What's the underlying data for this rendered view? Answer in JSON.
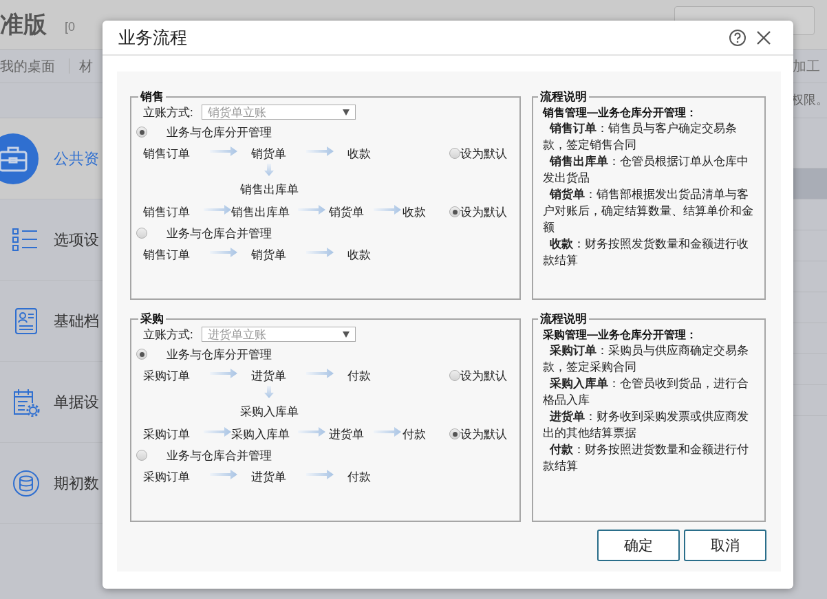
{
  "app": {
    "title": "准版",
    "code": "[0",
    "nav": [
      "我的桌面",
      "材"
    ],
    "nav_right": "加工",
    "notice": "权限。",
    "rows": [
      {
        "selected": false
      },
      {
        "selected": true
      },
      {
        "selected": false
      },
      {
        "selected": false
      },
      {
        "selected": false
      },
      {
        "selected": false
      },
      {
        "selected": false
      },
      {
        "selected": false
      },
      {
        "selected": false
      }
    ]
  },
  "sidebar": {
    "items": [
      {
        "label": "公共资",
        "selected": true
      },
      {
        "label": "选项设",
        "selected": false
      },
      {
        "label": "基础档",
        "selected": false
      },
      {
        "label": "单据设",
        "selected": false
      },
      {
        "label": "期初数",
        "selected": false
      }
    ]
  },
  "dialog": {
    "title": "业务流程",
    "sections": [
      {
        "title": "销售",
        "method": {
          "label": "立账方式:",
          "value": "销货单立账"
        },
        "modes": [
          {
            "label": "业务与仓库分开管理",
            "selected": true,
            "flows": [
              {
                "kind": "branch",
                "steps": [
                  "销售订单",
                  "销货单",
                  "收款"
                ],
                "branch": "销售出库单",
                "default": {
                  "label": "设为默认",
                  "selected": false
                }
              },
              {
                "kind": "linear",
                "steps": [
                  "销售订单",
                  "销售出库单",
                  "销货单",
                  "收款"
                ],
                "default": {
                  "label": "设为默认",
                  "selected": true
                }
              }
            ]
          },
          {
            "label": "业务与仓库合并管理",
            "selected": false,
            "flows": [
              {
                "kind": "linear",
                "steps": [
                  "销售订单",
                  "销货单",
                  "收款"
                ]
              }
            ]
          }
        ],
        "description": {
          "title": "流程说明",
          "heading": "销售管理—业务仓库分开管理：",
          "items": [
            "**销售订单**：销售员与客户确定交易条款，签定销售合同",
            "**销售出库单**：仓管员根据订单从仓库中发出货品",
            "**销货单**：销售部根据发出货品清单与客户对账后，确定结算数量、结算单价和金额",
            "**收款**：财务按照发货数量和金额进行收款结算"
          ]
        }
      },
      {
        "title": "采购",
        "method": {
          "label": "立账方式:",
          "value": "进货单立账"
        },
        "modes": [
          {
            "label": "业务与仓库分开管理",
            "selected": true,
            "flows": [
              {
                "kind": "branch",
                "steps": [
                  "采购订单",
                  "进货单",
                  "付款"
                ],
                "branch": "采购入库单",
                "default": {
                  "label": "设为默认",
                  "selected": false
                }
              },
              {
                "kind": "linear",
                "steps": [
                  "采购订单",
                  "采购入库单",
                  "进货单",
                  "付款"
                ],
                "default": {
                  "label": "设为默认",
                  "selected": true
                }
              }
            ]
          },
          {
            "label": "业务与仓库合并管理",
            "selected": false,
            "flows": [
              {
                "kind": "linear",
                "steps": [
                  "采购订单",
                  "进货单",
                  "付款"
                ]
              }
            ]
          }
        ],
        "description": {
          "title": "流程说明",
          "heading": "采购管理—业务仓库分开管理：",
          "items": [
            "**采购订单**：采购员与供应商确定交易条款，签定采购合同",
            "**采购入库单**：仓管员收到货品，进行合格品入库",
            "**进货单**：财务收到采购发票或供应商发出的其他结算票据",
            "**付款**：财务按照进货数量和金额进行付款结算"
          ]
        }
      }
    ],
    "buttons": [
      "确定",
      "取消"
    ]
  }
}
